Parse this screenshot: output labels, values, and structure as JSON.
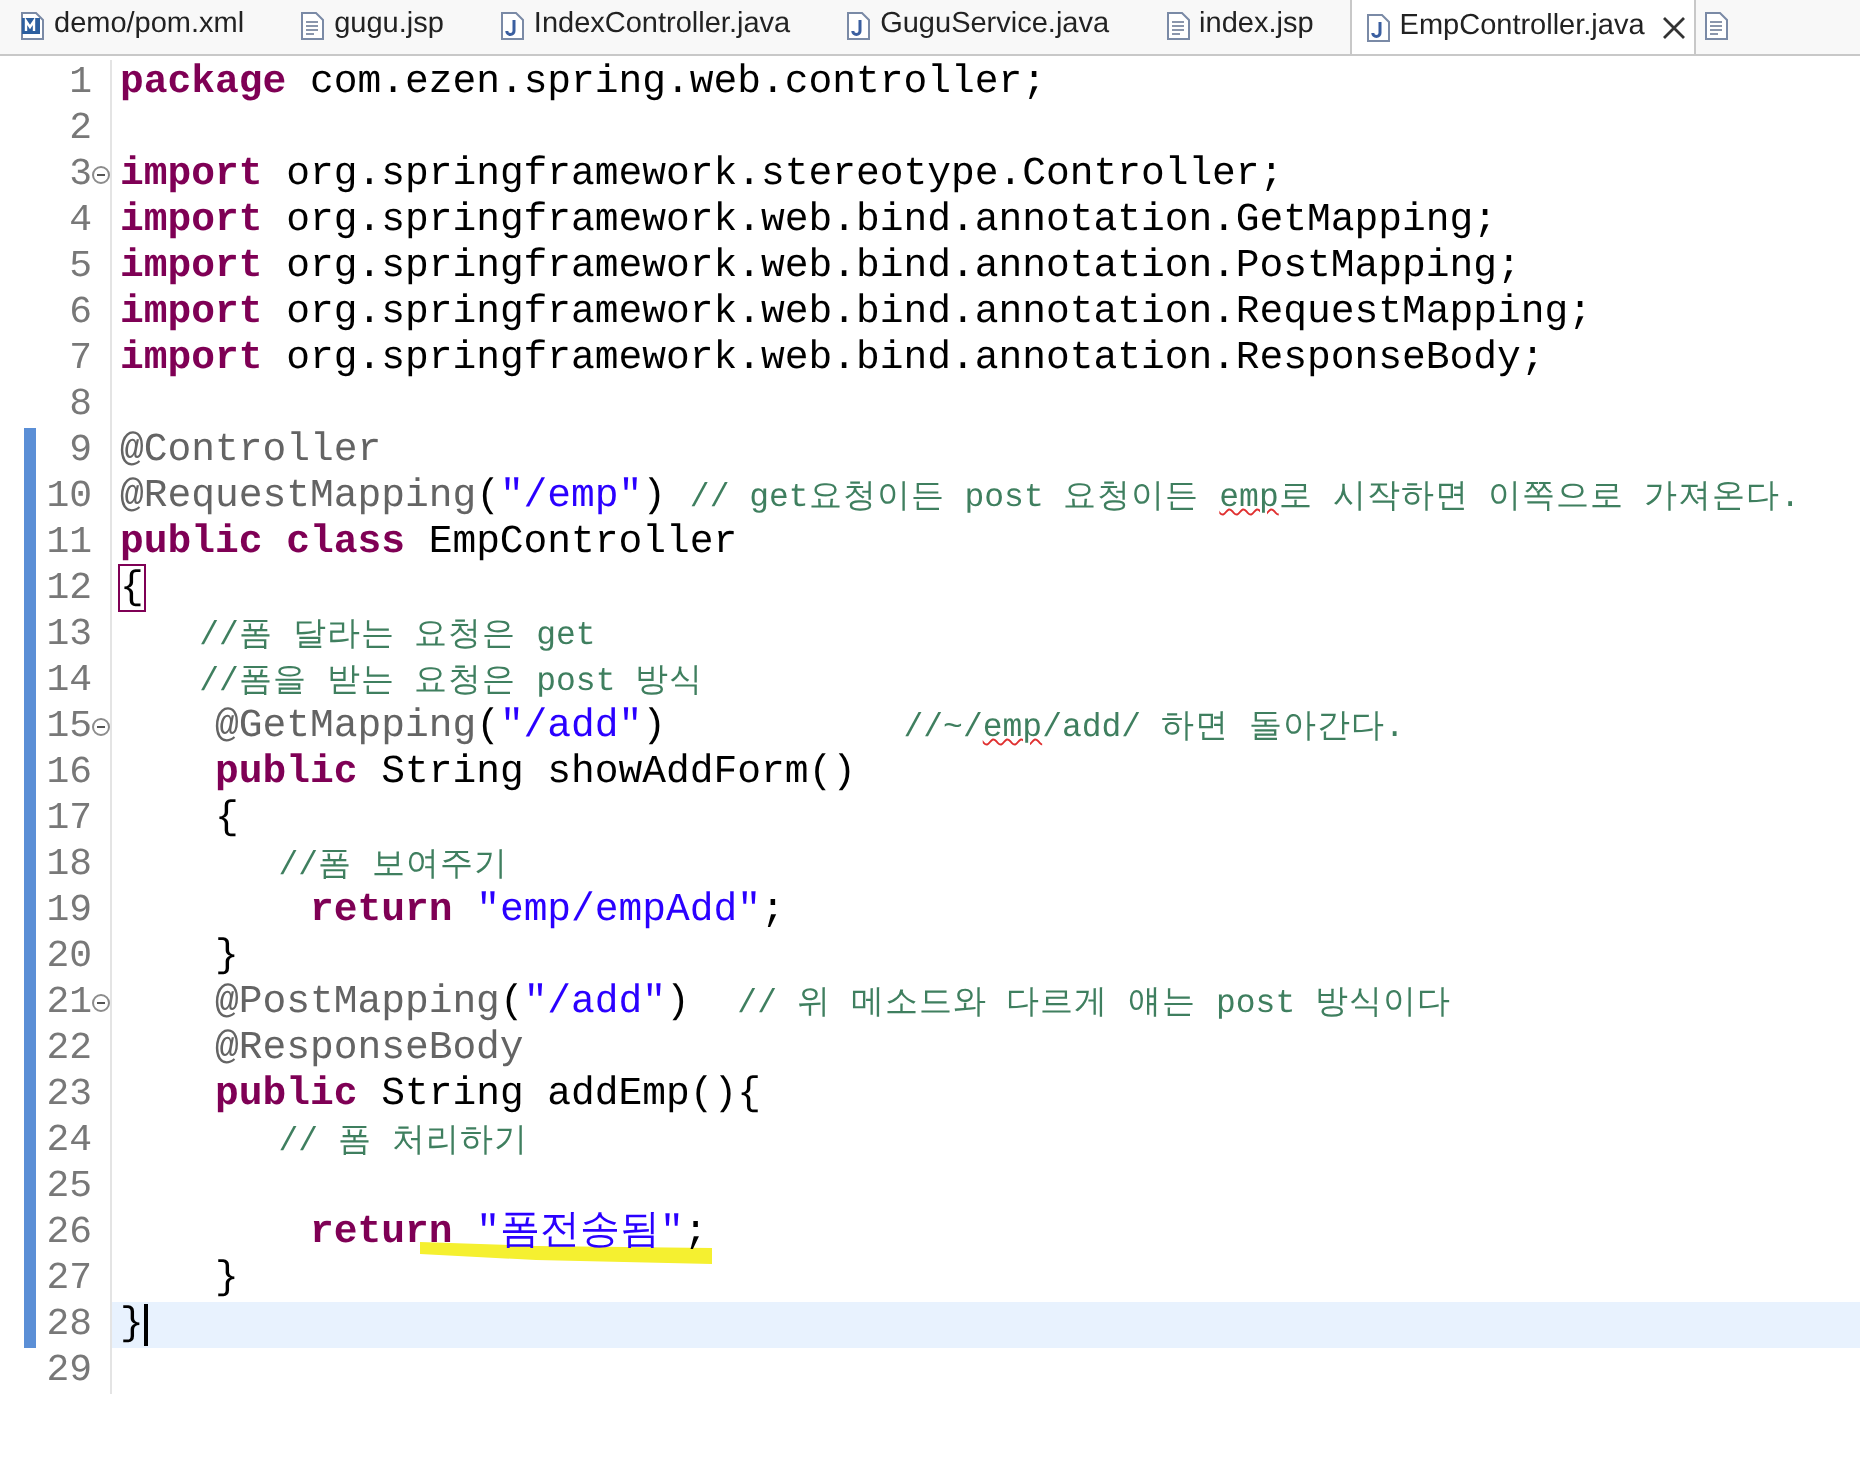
{
  "tabs": [
    {
      "label": "demo/pom.xml",
      "kind": "maven",
      "selected": false
    },
    {
      "label": "gugu.jsp",
      "kind": "jsp",
      "selected": false
    },
    {
      "label": "IndexController.java",
      "kind": "java",
      "selected": false
    },
    {
      "label": "GuguService.java",
      "kind": "java",
      "selected": false
    },
    {
      "label": "index.jsp",
      "kind": "jsp",
      "selected": false
    },
    {
      "label": "EmpController.java",
      "kind": "java",
      "selected": true,
      "closable": true
    }
  ],
  "overflow_tab": {
    "kind": "jsp"
  },
  "editor": {
    "lines": [
      {
        "number": "1",
        "tokens": [
          {
            "kind": "keyword",
            "text": "package"
          },
          {
            "kind": "plain",
            "text": " com.ezen.spring.web.controller;"
          }
        ]
      },
      {
        "number": "2"
      },
      {
        "number": "3",
        "folding": true,
        "tokens": [
          {
            "kind": "keyword",
            "text": "import"
          },
          {
            "kind": "plain",
            "text": " org.springframework.stereotype.Controller;"
          }
        ]
      },
      {
        "number": "4",
        "tokens": [
          {
            "kind": "keyword",
            "text": "import"
          },
          {
            "kind": "plain",
            "text": " org.springframework.web.bind.annotation.GetMapping;"
          }
        ]
      },
      {
        "number": "5",
        "tokens": [
          {
            "kind": "keyword",
            "text": "import"
          },
          {
            "kind": "plain",
            "text": " org.springframework.web.bind.annotation.PostMapping;"
          }
        ]
      },
      {
        "number": "6",
        "tokens": [
          {
            "kind": "keyword",
            "text": "import"
          },
          {
            "kind": "plain",
            "text": " org.springframework.web.bind.annotation.RequestMapping;"
          }
        ]
      },
      {
        "number": "7",
        "tokens": [
          {
            "kind": "keyword",
            "text": "import"
          },
          {
            "kind": "plain",
            "text": " org.springframework.web.bind.annotation.ResponseBody;"
          }
        ]
      },
      {
        "number": "8"
      },
      {
        "number": "9",
        "changed": true,
        "tokens": [
          {
            "kind": "annotation",
            "text": "@Controller"
          }
        ]
      },
      {
        "number": "10",
        "changed": true,
        "tokens": [
          {
            "kind": "annotation",
            "text": "@RequestMapping"
          },
          {
            "kind": "plain",
            "text": "("
          },
          {
            "kind": "string",
            "text": "\"/emp\""
          },
          {
            "kind": "plain",
            "text": ") "
          },
          {
            "kind": "comment",
            "text": "// get요청이든 post 요청이든 "
          },
          {
            "kind": "comment",
            "text": "emp",
            "misspelled": true
          },
          {
            "kind": "comment",
            "text": "로 시작하면 이쪽으로 가져온다."
          }
        ]
      },
      {
        "number": "11",
        "changed": true,
        "tokens": [
          {
            "kind": "keyword",
            "text": "public class"
          },
          {
            "kind": "plain",
            "text": " EmpController"
          }
        ]
      },
      {
        "number": "12",
        "changed": true,
        "tokens": [
          {
            "kind": "plain",
            "text": "{",
            "bracket_match": true
          }
        ]
      },
      {
        "number": "13",
        "changed": true,
        "tokens": [
          {
            "kind": "comment",
            "text": "    //폼 달라는 요청은 get"
          }
        ]
      },
      {
        "number": "14",
        "changed": true,
        "tokens": [
          {
            "kind": "comment",
            "text": "    //폼을 받는 요청은 post 방식"
          }
        ]
      },
      {
        "number": "15",
        "changed": true,
        "folding": true,
        "tokens": [
          {
            "kind": "annotation",
            "text": "    @GetMapping"
          },
          {
            "kind": "plain",
            "text": "("
          },
          {
            "kind": "string",
            "text": "\"/add\""
          },
          {
            "kind": "plain",
            "text": ")          "
          },
          {
            "kind": "comment",
            "text": "//~/"
          },
          {
            "kind": "comment",
            "text": "emp",
            "misspelled": true
          },
          {
            "kind": "comment",
            "text": "/add/ 하면 돌아간다."
          }
        ]
      },
      {
        "number": "16",
        "changed": true,
        "tokens": [
          {
            "kind": "keyword",
            "text": "    public"
          },
          {
            "kind": "plain",
            "text": " String showAddForm()"
          }
        ]
      },
      {
        "number": "17",
        "changed": true,
        "tokens": [
          {
            "kind": "plain",
            "text": "    {"
          }
        ]
      },
      {
        "number": "18",
        "changed": true,
        "tokens": [
          {
            "kind": "comment",
            "text": "        //폼 보여주기"
          }
        ]
      },
      {
        "number": "19",
        "changed": true,
        "tokens": [
          {
            "kind": "keyword",
            "text": "        return"
          },
          {
            "kind": "string",
            "text": " \"emp/empAdd\""
          },
          {
            "kind": "plain",
            "text": ";"
          }
        ]
      },
      {
        "number": "20",
        "changed": true,
        "tokens": [
          {
            "kind": "plain",
            "text": "    }"
          }
        ]
      },
      {
        "number": "21",
        "changed": true,
        "folding": true,
        "tokens": [
          {
            "kind": "annotation",
            "text": "    @PostMapping"
          },
          {
            "kind": "plain",
            "text": "("
          },
          {
            "kind": "string",
            "text": "\"/add\""
          },
          {
            "kind": "plain",
            "text": ")  "
          },
          {
            "kind": "comment",
            "text": "// 위 메소드와 다르게 얘는 post 방식이다"
          }
        ]
      },
      {
        "number": "22",
        "changed": true,
        "tokens": [
          {
            "kind": "annotation",
            "text": "    @ResponseBody"
          }
        ]
      },
      {
        "number": "23",
        "changed": true,
        "tokens": [
          {
            "kind": "keyword",
            "text": "    public"
          },
          {
            "kind": "plain",
            "text": " String addEmp(){"
          }
        ]
      },
      {
        "number": "24",
        "changed": true,
        "tokens": [
          {
            "kind": "comment",
            "text": "        // 폼 처리하기"
          }
        ]
      },
      {
        "number": "25",
        "changed": true
      },
      {
        "number": "26",
        "changed": true,
        "highlighter_mark": true,
        "tokens": [
          {
            "kind": "keyword",
            "text": "        return"
          },
          {
            "kind": "string",
            "text": " \"폼전송됨\""
          },
          {
            "kind": "plain",
            "text": ";"
          }
        ]
      },
      {
        "number": "27",
        "changed": true,
        "tokens": [
          {
            "kind": "plain",
            "text": "    }"
          }
        ]
      },
      {
        "number": "28",
        "changed": true,
        "current": true,
        "cursor": true,
        "tokens": [
          {
            "kind": "plain",
            "text": "}"
          }
        ]
      },
      {
        "number": "29"
      }
    ]
  }
}
